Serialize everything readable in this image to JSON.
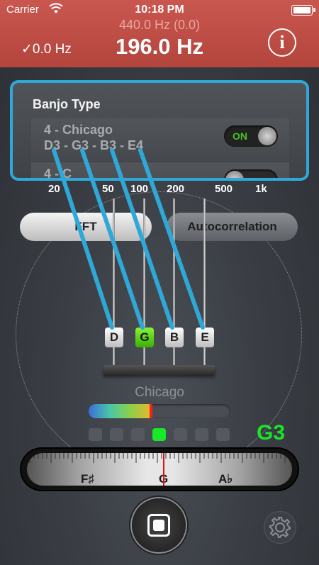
{
  "status": {
    "carrier": "Carrier",
    "time": "10:18 PM"
  },
  "header": {
    "reference_frequency": "440.0 Hz (0.0)",
    "offset": "✓0.0 Hz",
    "detected_frequency": "196.0 Hz",
    "info_icon_char": "i"
  },
  "popup": {
    "title": "Banjo Type",
    "options": [
      {
        "name": "4 - Chicago",
        "notes": "D3 - G3 - B3 - E4",
        "toggle_label": "ON",
        "selected": true
      },
      {
        "name": "4 - C",
        "notes": "",
        "toggle_label": "",
        "selected": false
      }
    ]
  },
  "frequency_scale": [
    "20",
    "50",
    "100",
    "200",
    "500",
    "1k"
  ],
  "modes": {
    "fft": "FFT",
    "autocorrelation": "Autocorrelation"
  },
  "strings": [
    {
      "note": "D",
      "active": false
    },
    {
      "note": "G",
      "active": true
    },
    {
      "note": "B",
      "active": false
    },
    {
      "note": "E",
      "active": false
    }
  ],
  "tuning_name": "Chicago",
  "level": {
    "fill_fraction": 0.44
  },
  "pitch_dots": {
    "count": 7,
    "active_index": 3
  },
  "detected_note": "G3",
  "needle_meter": {
    "left_label": "F♯",
    "center_label": "G",
    "right_label": "A♭",
    "needle_cents": 0
  },
  "icons": {
    "wifi": "wifi-icon",
    "battery": "battery-icon",
    "info": "info-icon",
    "stop": "stop-icon",
    "settings": "gear-icon"
  },
  "colors": {
    "header": "#b3453d",
    "highlight": "#2fa8d8",
    "active_note": "#1ae528",
    "needle": "#e31414"
  }
}
